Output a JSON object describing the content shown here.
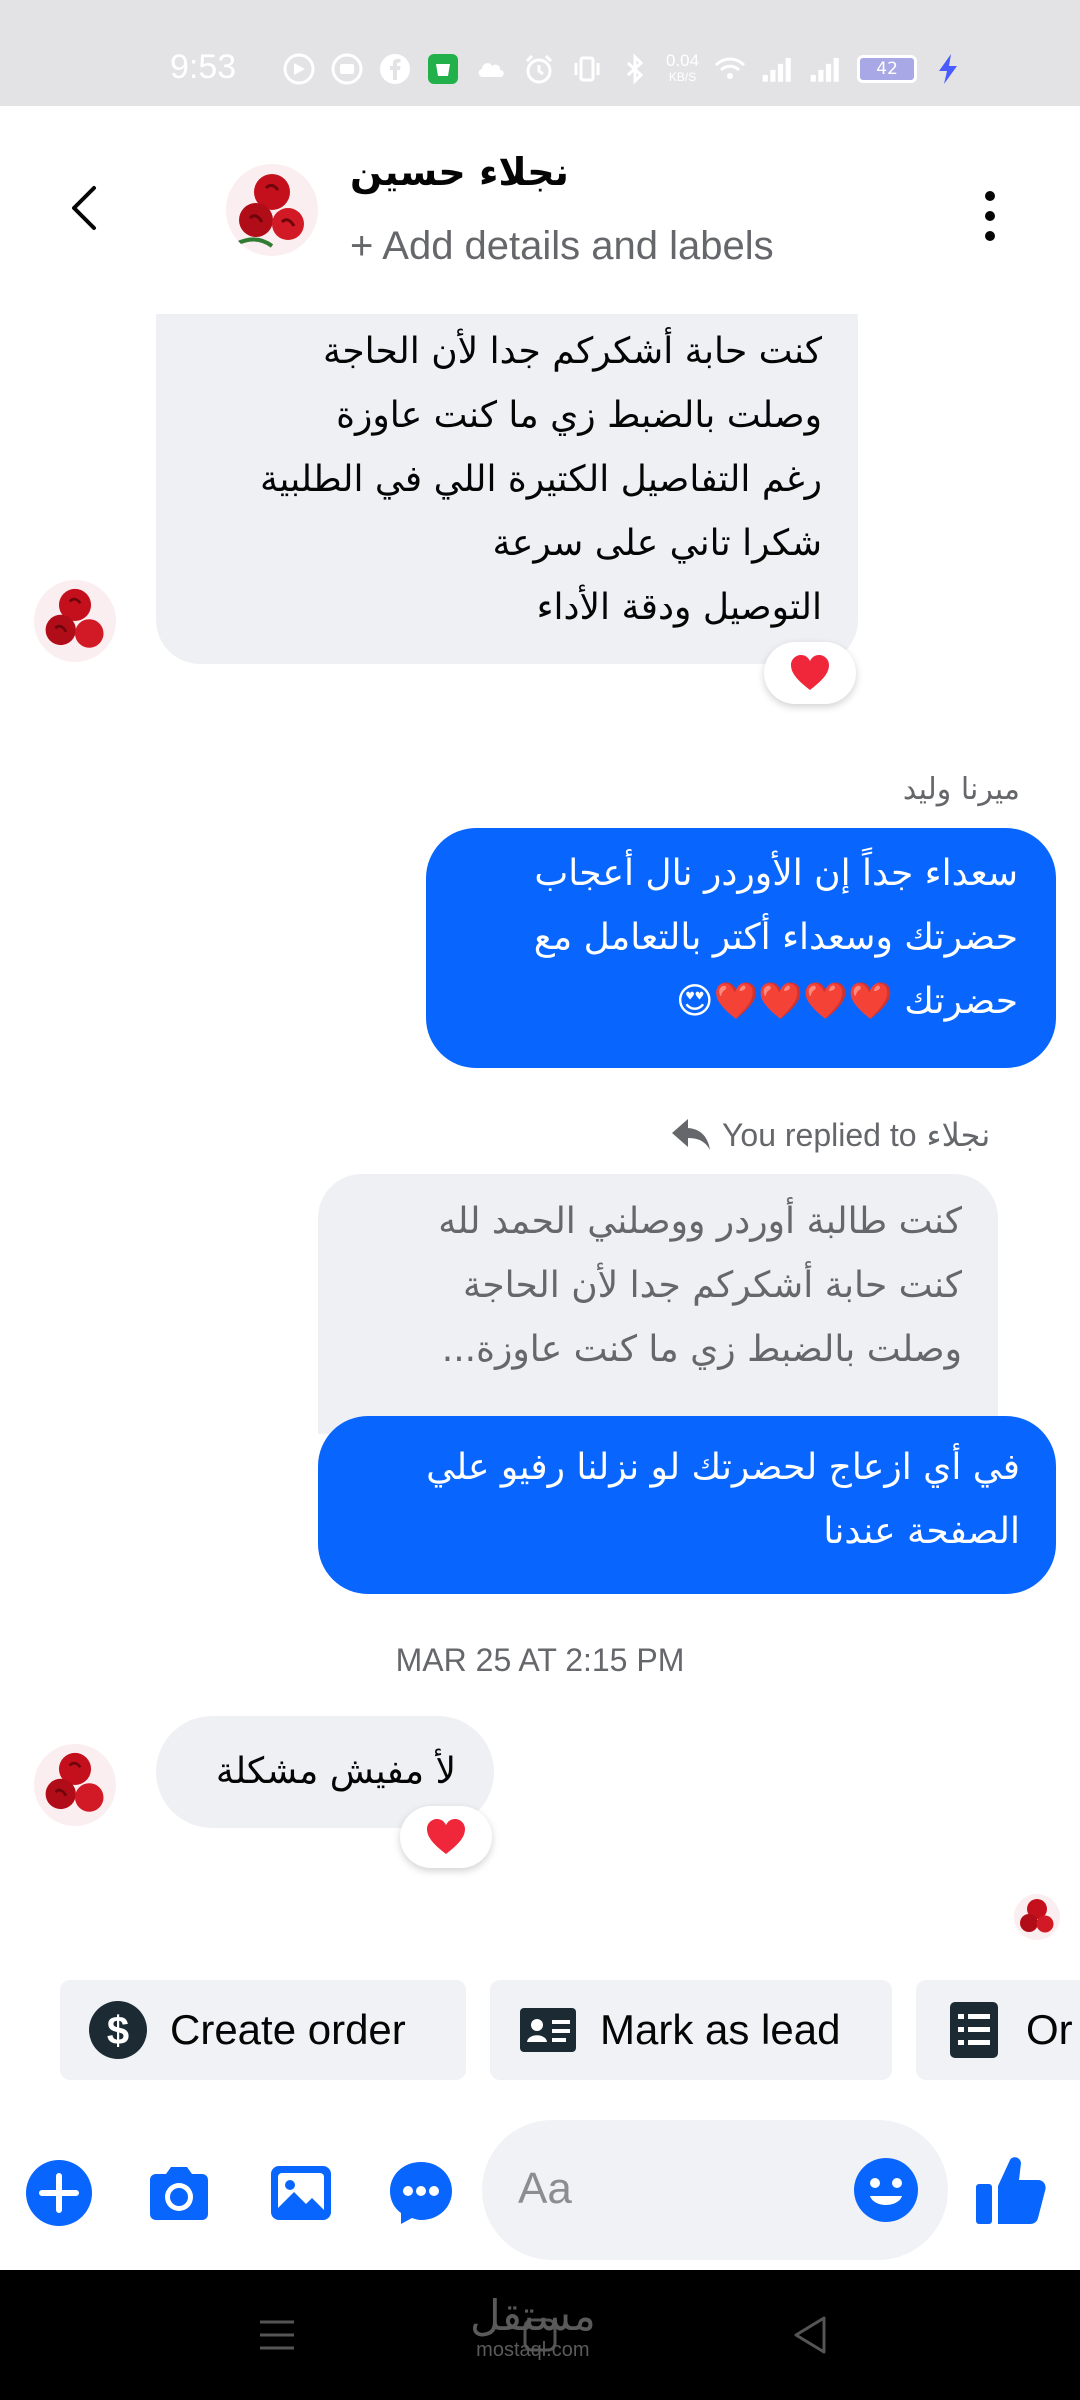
{
  "status_bar": {
    "time": "9:53",
    "net_speed": "0.04",
    "net_unit": "KB/S",
    "battery": "42"
  },
  "header": {
    "contact_name": "نجلاء حسين",
    "subtitle": "+ Add details and labels"
  },
  "messages": {
    "incoming_1": {
      "lines": [
        "كنت حابة أشكركم جدا لأن الحاجة",
        "وصلت بالضبط زي ما كنت عاوزة",
        "رغم التفاصيل الكتيرة اللي في الطلبية",
        "شكرا تاني على سرعة",
        "التوصيل ودقة الأداء"
      ],
      "reaction": "❤️"
    },
    "outgoing_1": {
      "sender": "ميرنا وليد",
      "lines": [
        "سعداء جداً إن الأوردر نال أعجاب",
        "حضرتك وسعداء أكتر بالتعامل مع",
        "حضرتك ❤️❤️❤️❤️😍"
      ]
    },
    "reply": {
      "replied_label": "You replied to",
      "replied_name": "نجلاء",
      "quote_lines": [
        "كنت طالبة أوردر ووصلني الحمد لله",
        "كنت حابة أشكركم جدا لأن الحاجة",
        "وصلت بالضبط زي ما كنت عاوزة..."
      ],
      "lines": [
        "في أي ازعاج لحضرتك لو نزلنا رفيو علي",
        "الصفحة عندنا"
      ]
    },
    "timestamp": "MAR 25 AT 2:15 PM",
    "incoming_2": {
      "text": "لأ مفيش مشكلة",
      "reaction": "❤️"
    }
  },
  "quick_actions": [
    {
      "label": "Create order",
      "icon": "dollar-icon"
    },
    {
      "label": "Mark as lead",
      "icon": "id-card-icon"
    },
    {
      "label": "Or",
      "icon": "list-doc-icon"
    }
  ],
  "composer": {
    "placeholder": "Aa"
  },
  "watermark": {
    "ar": "مستقل",
    "en": "mostaql.com"
  },
  "colors": {
    "accent": "#0866ff",
    "incoming_bubble": "#eef0f4",
    "status_bar": "#e3e3e6"
  }
}
